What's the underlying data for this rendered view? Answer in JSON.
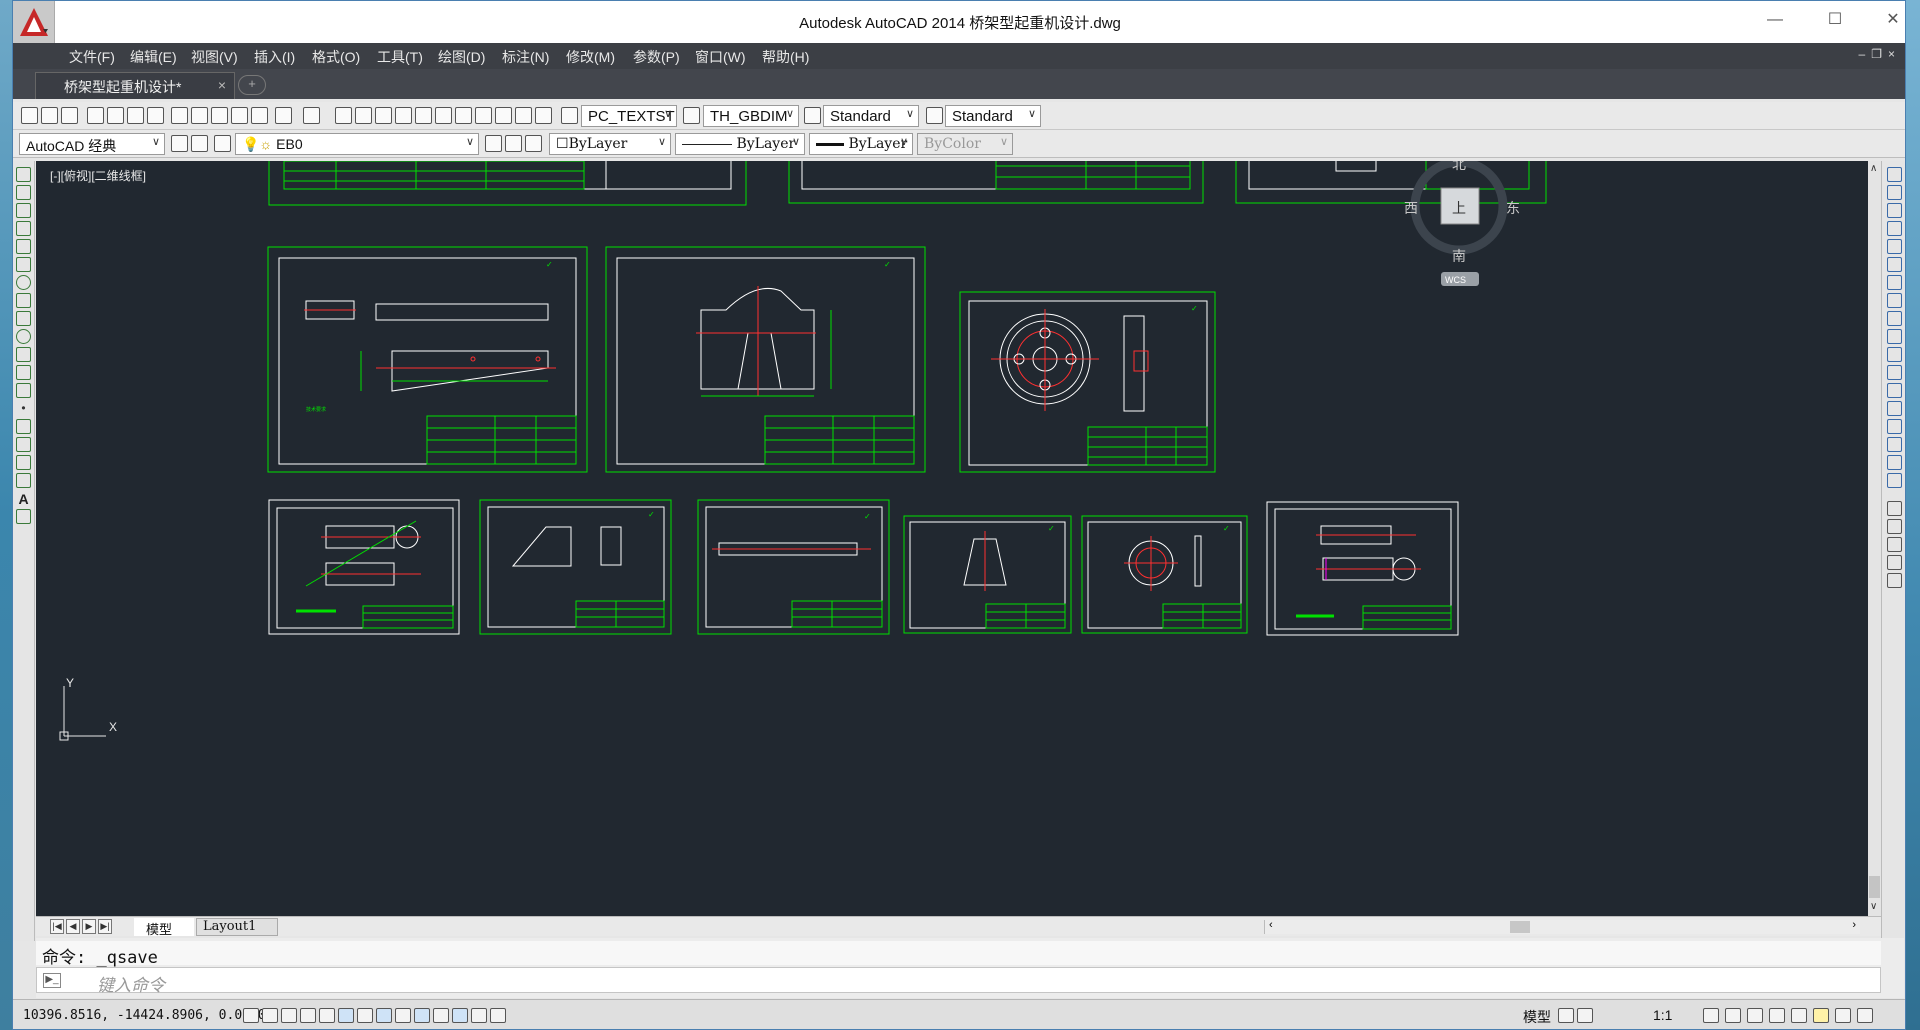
{
  "window": {
    "title": "Autodesk AutoCAD 2014    桥架型起重机设计.dwg",
    "minimize_icon": "minimize-icon",
    "maximize_icon": "maximize-icon",
    "close_icon": "close-icon"
  },
  "menu": [
    {
      "label": "文件(F)"
    },
    {
      "label": "编辑(E)"
    },
    {
      "label": "视图(V)"
    },
    {
      "label": "插入(I)"
    },
    {
      "label": "格式(O)"
    },
    {
      "label": "工具(T)"
    },
    {
      "label": "绘图(D)"
    },
    {
      "label": "标注(N)"
    },
    {
      "label": "修改(M)"
    },
    {
      "label": "参数(P)"
    },
    {
      "label": "窗口(W)"
    },
    {
      "label": "帮助(H)"
    }
  ],
  "doc_tab": {
    "label": "桥架型起重机设计*",
    "close": "×",
    "new_tab_icon": "plus-icon"
  },
  "toolbar": {
    "text_style": "PC_TEXTST",
    "dim_style": "TH_GBDIM",
    "table_style": "Standard",
    "multileader_style": "Standard"
  },
  "properties_bar": {
    "workspace": "AutoCAD 经典",
    "layer": "EB0",
    "color": "ByLayer",
    "linetype": "ByLayer",
    "lineweight": "ByLayer",
    "plot_style": "ByColor"
  },
  "viewport": {
    "label": "[-][俯视][二维线框]",
    "viewcube": {
      "north": "北",
      "south": "南",
      "east": "东",
      "west": "西",
      "face": "上",
      "wcs": "WCS"
    },
    "ucs": {
      "x": "X",
      "y": "Y"
    }
  },
  "layout_tabs": [
    "模型",
    "Layout1"
  ],
  "command": {
    "history": "命令: _qsave",
    "placeholder": "键入命令"
  },
  "status": {
    "coordinates": "10396.8516, -14424.8906, 0.0000",
    "model": "模型",
    "annotation_scale": "1:1"
  },
  "colors": {
    "canvas": "#212830",
    "drawing_border": "#00e000",
    "drawing_line": "#ffffff",
    "accent_red": "#ff3030",
    "menubar": "#3c3f45"
  }
}
